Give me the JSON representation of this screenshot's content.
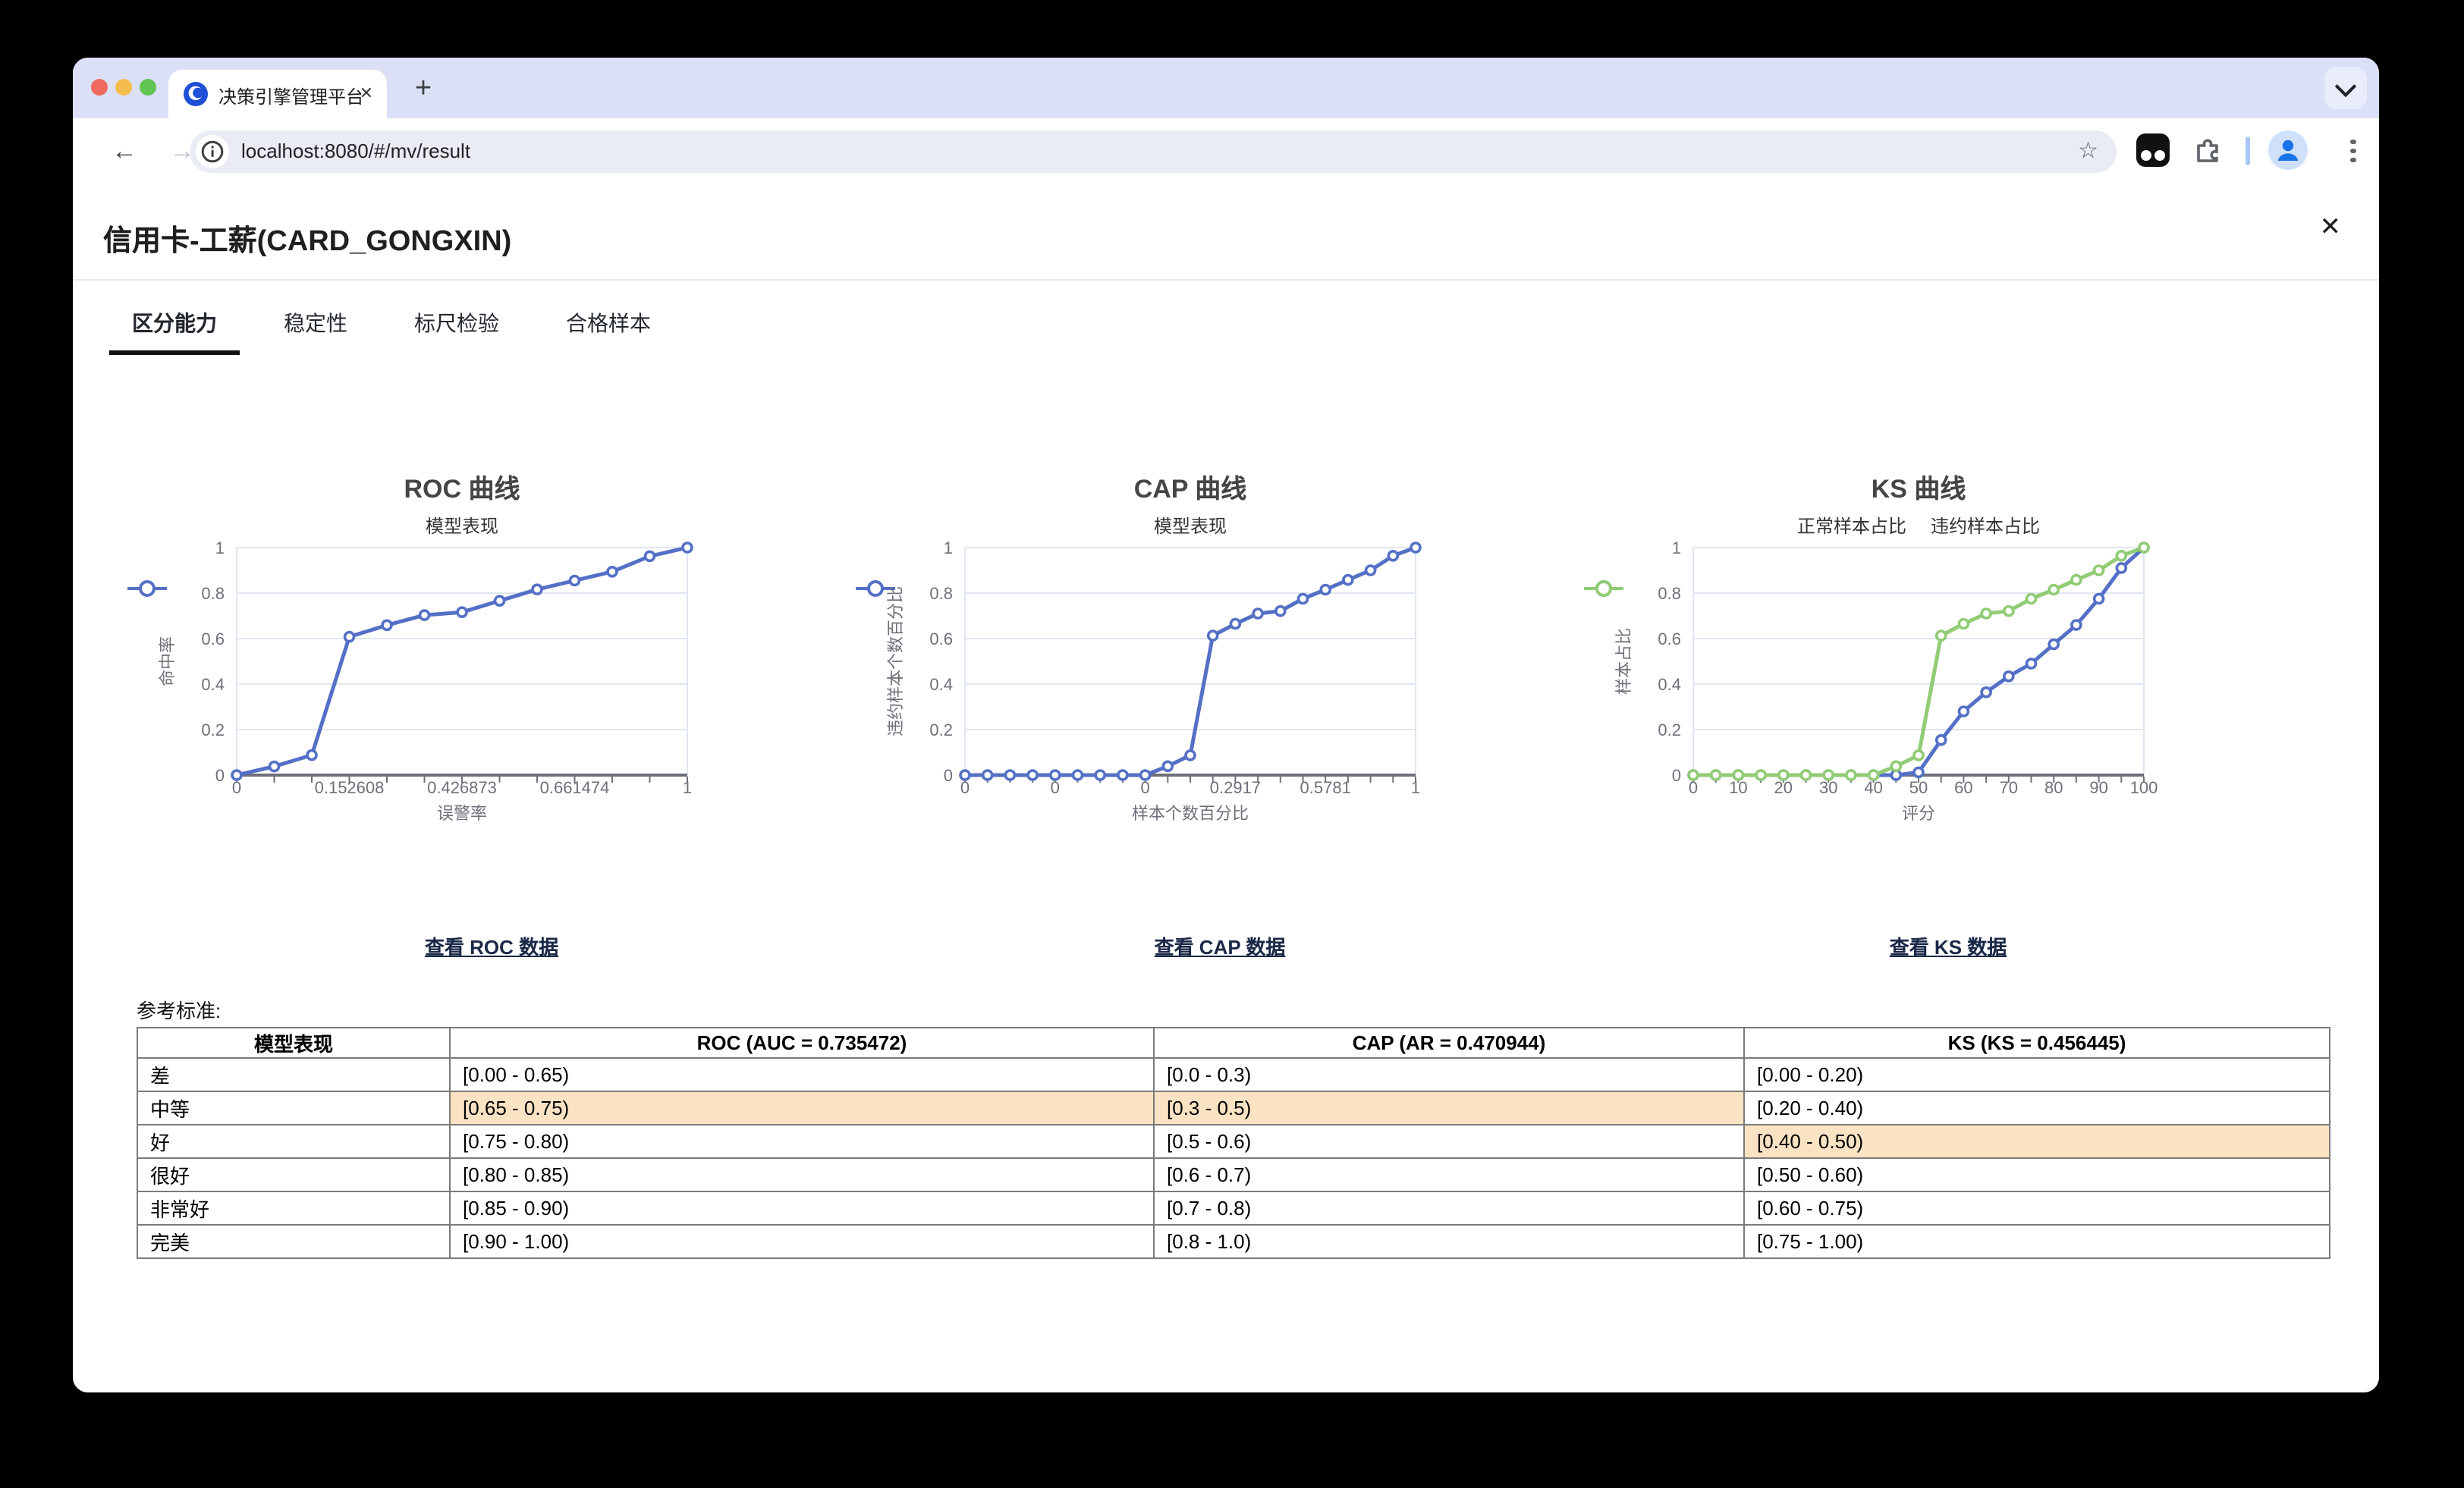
{
  "browser": {
    "tab_title": "决策引擎管理平台",
    "url": "localhost:8080/#/mv/result"
  },
  "icons": {
    "back": "←",
    "forward": "→",
    "reload": "⟳",
    "star": "☆",
    "plus": "+",
    "tab_close": "✕",
    "page_close": "✕"
  },
  "page": {
    "title": "信用卡-工薪(CARD_GONGXIN)",
    "tabs": [
      {
        "label": "区分能力",
        "active": true
      },
      {
        "label": "稳定性",
        "active": false
      },
      {
        "label": "标尺检验",
        "active": false
      },
      {
        "label": "合格样本",
        "active": false
      }
    ],
    "links": [
      "查看 ROC 数据",
      "查看 CAP 数据",
      "查看 KS 数据"
    ],
    "reference_label": "参考标准:",
    "table": {
      "headers": [
        "模型表现",
        "ROC (AUC = 0.735472)",
        "CAP (AR = 0.470944)",
        "KS (KS = 0.456445)"
      ],
      "rows": [
        {
          "cells": [
            "差",
            "[0.00 - 0.65)",
            "[0.0 - 0.3)",
            "[0.00 - 0.20)"
          ],
          "highlight": []
        },
        {
          "cells": [
            "中等",
            "[0.65 - 0.75)",
            "[0.3 - 0.5)",
            "[0.20 - 0.40)"
          ],
          "highlight": [
            1,
            2
          ]
        },
        {
          "cells": [
            "好",
            "[0.75 - 0.80)",
            "[0.5 - 0.6)",
            "[0.40 - 0.50)"
          ],
          "highlight": [
            3
          ]
        },
        {
          "cells": [
            "很好",
            "[0.80 - 0.85)",
            "[0.6 - 0.7)",
            "[0.50 - 0.60)"
          ],
          "highlight": []
        },
        {
          "cells": [
            "非常好",
            "[0.85 - 0.90)",
            "[0.7 - 0.8)",
            "[0.60 - 0.75)"
          ],
          "highlight": []
        },
        {
          "cells": [
            "完美",
            "[0.90 - 1.00)",
            "[0.8 - 1.0)",
            "[0.75 - 1.00)"
          ],
          "highlight": []
        }
      ],
      "highlight_color": "#FAE3C3"
    }
  },
  "colors": {
    "series_blue": "#5470C6",
    "series_green": "#91CC75",
    "axis_label": "#6E7079",
    "grid_line": "#E0E6F1",
    "axis_line": "#6E7079",
    "link_navy": "#1b2948",
    "highlight_orange": "#FAE3C3"
  },
  "chart_data": [
    {
      "type": "line",
      "title": "ROC 曲线",
      "x_title": "误警率",
      "y_title": "命中率",
      "ylim": [
        0,
        1
      ],
      "y_ticks": [
        "0",
        "0.2",
        "0.4",
        "0.6",
        "0.8",
        "1"
      ],
      "grid": true,
      "legend_position": "top",
      "x_labels": [
        "0",
        "",
        "",
        "0.152608",
        "",
        "",
        "0.426873",
        "",
        "",
        "0.661474",
        "",
        "",
        "1"
      ],
      "legend": [
        {
          "name": "模型表现",
          "color": "#5470C6"
        }
      ],
      "series": [
        {
          "name": "模型表现",
          "color": "#5470C6",
          "values": [
            0,
            0.038,
            0.088,
            0.608,
            0.659,
            0.703,
            0.716,
            0.766,
            0.816,
            0.855,
            0.894,
            0.962,
            1
          ]
        }
      ]
    },
    {
      "type": "line",
      "title": "CAP 曲线",
      "x_title": "样本个数百分比",
      "y_title": "违约样本个数百分比",
      "ylim": [
        0,
        1
      ],
      "y_ticks": [
        "0",
        "0.2",
        "0.4",
        "0.6",
        "0.8",
        "1"
      ],
      "grid": true,
      "legend_position": "top",
      "x_labels": [
        "0",
        "",
        "",
        "",
        "0",
        "",
        "",
        "",
        "0",
        "",
        "",
        "",
        "0.2917",
        "",
        "",
        "",
        "0.5781",
        "",
        "",
        "",
        "1"
      ],
      "legend": [
        {
          "name": "模型表现",
          "color": "#5470C6"
        }
      ],
      "series": [
        {
          "name": "模型表现",
          "color": "#5470C6",
          "values": [
            0,
            0,
            0,
            0,
            0,
            0,
            0,
            0,
            0,
            0.039,
            0.087,
            0.613,
            0.665,
            0.71,
            0.721,
            0.775,
            0.815,
            0.858,
            0.9,
            0.964,
            1
          ]
        }
      ]
    },
    {
      "type": "line",
      "title": "KS 曲线",
      "x_title": "评分",
      "y_title": "样本占比",
      "ylim": [
        0,
        1
      ],
      "y_ticks": [
        "0",
        "0.2",
        "0.4",
        "0.6",
        "0.8",
        "1"
      ],
      "grid": true,
      "legend_position": "top",
      "x_labels": [
        "0",
        "",
        "10",
        "",
        "20",
        "",
        "30",
        "",
        "40",
        "",
        "50",
        "",
        "60",
        "",
        "70",
        "",
        "80",
        "",
        "90",
        "",
        "100"
      ],
      "legend": [
        {
          "name": "正常样本占比",
          "color": "#5470C6"
        },
        {
          "name": "违约样本占比",
          "color": "#91CC75"
        }
      ],
      "series": [
        {
          "name": "正常样本占比",
          "color": "#5470C6",
          "values": [
            0,
            0,
            0,
            0,
            0,
            0,
            0,
            0,
            0,
            0,
            0.012,
            0.154,
            0.28,
            0.364,
            0.434,
            0.49,
            0.575,
            0.66,
            0.775,
            0.91,
            1
          ]
        },
        {
          "name": "违约样本占比",
          "color": "#91CC75",
          "values": [
            0,
            0,
            0,
            0,
            0,
            0,
            0,
            0,
            0,
            0.039,
            0.087,
            0.613,
            0.665,
            0.71,
            0.721,
            0.775,
            0.815,
            0.858,
            0.9,
            0.964,
            1
          ]
        }
      ]
    }
  ]
}
